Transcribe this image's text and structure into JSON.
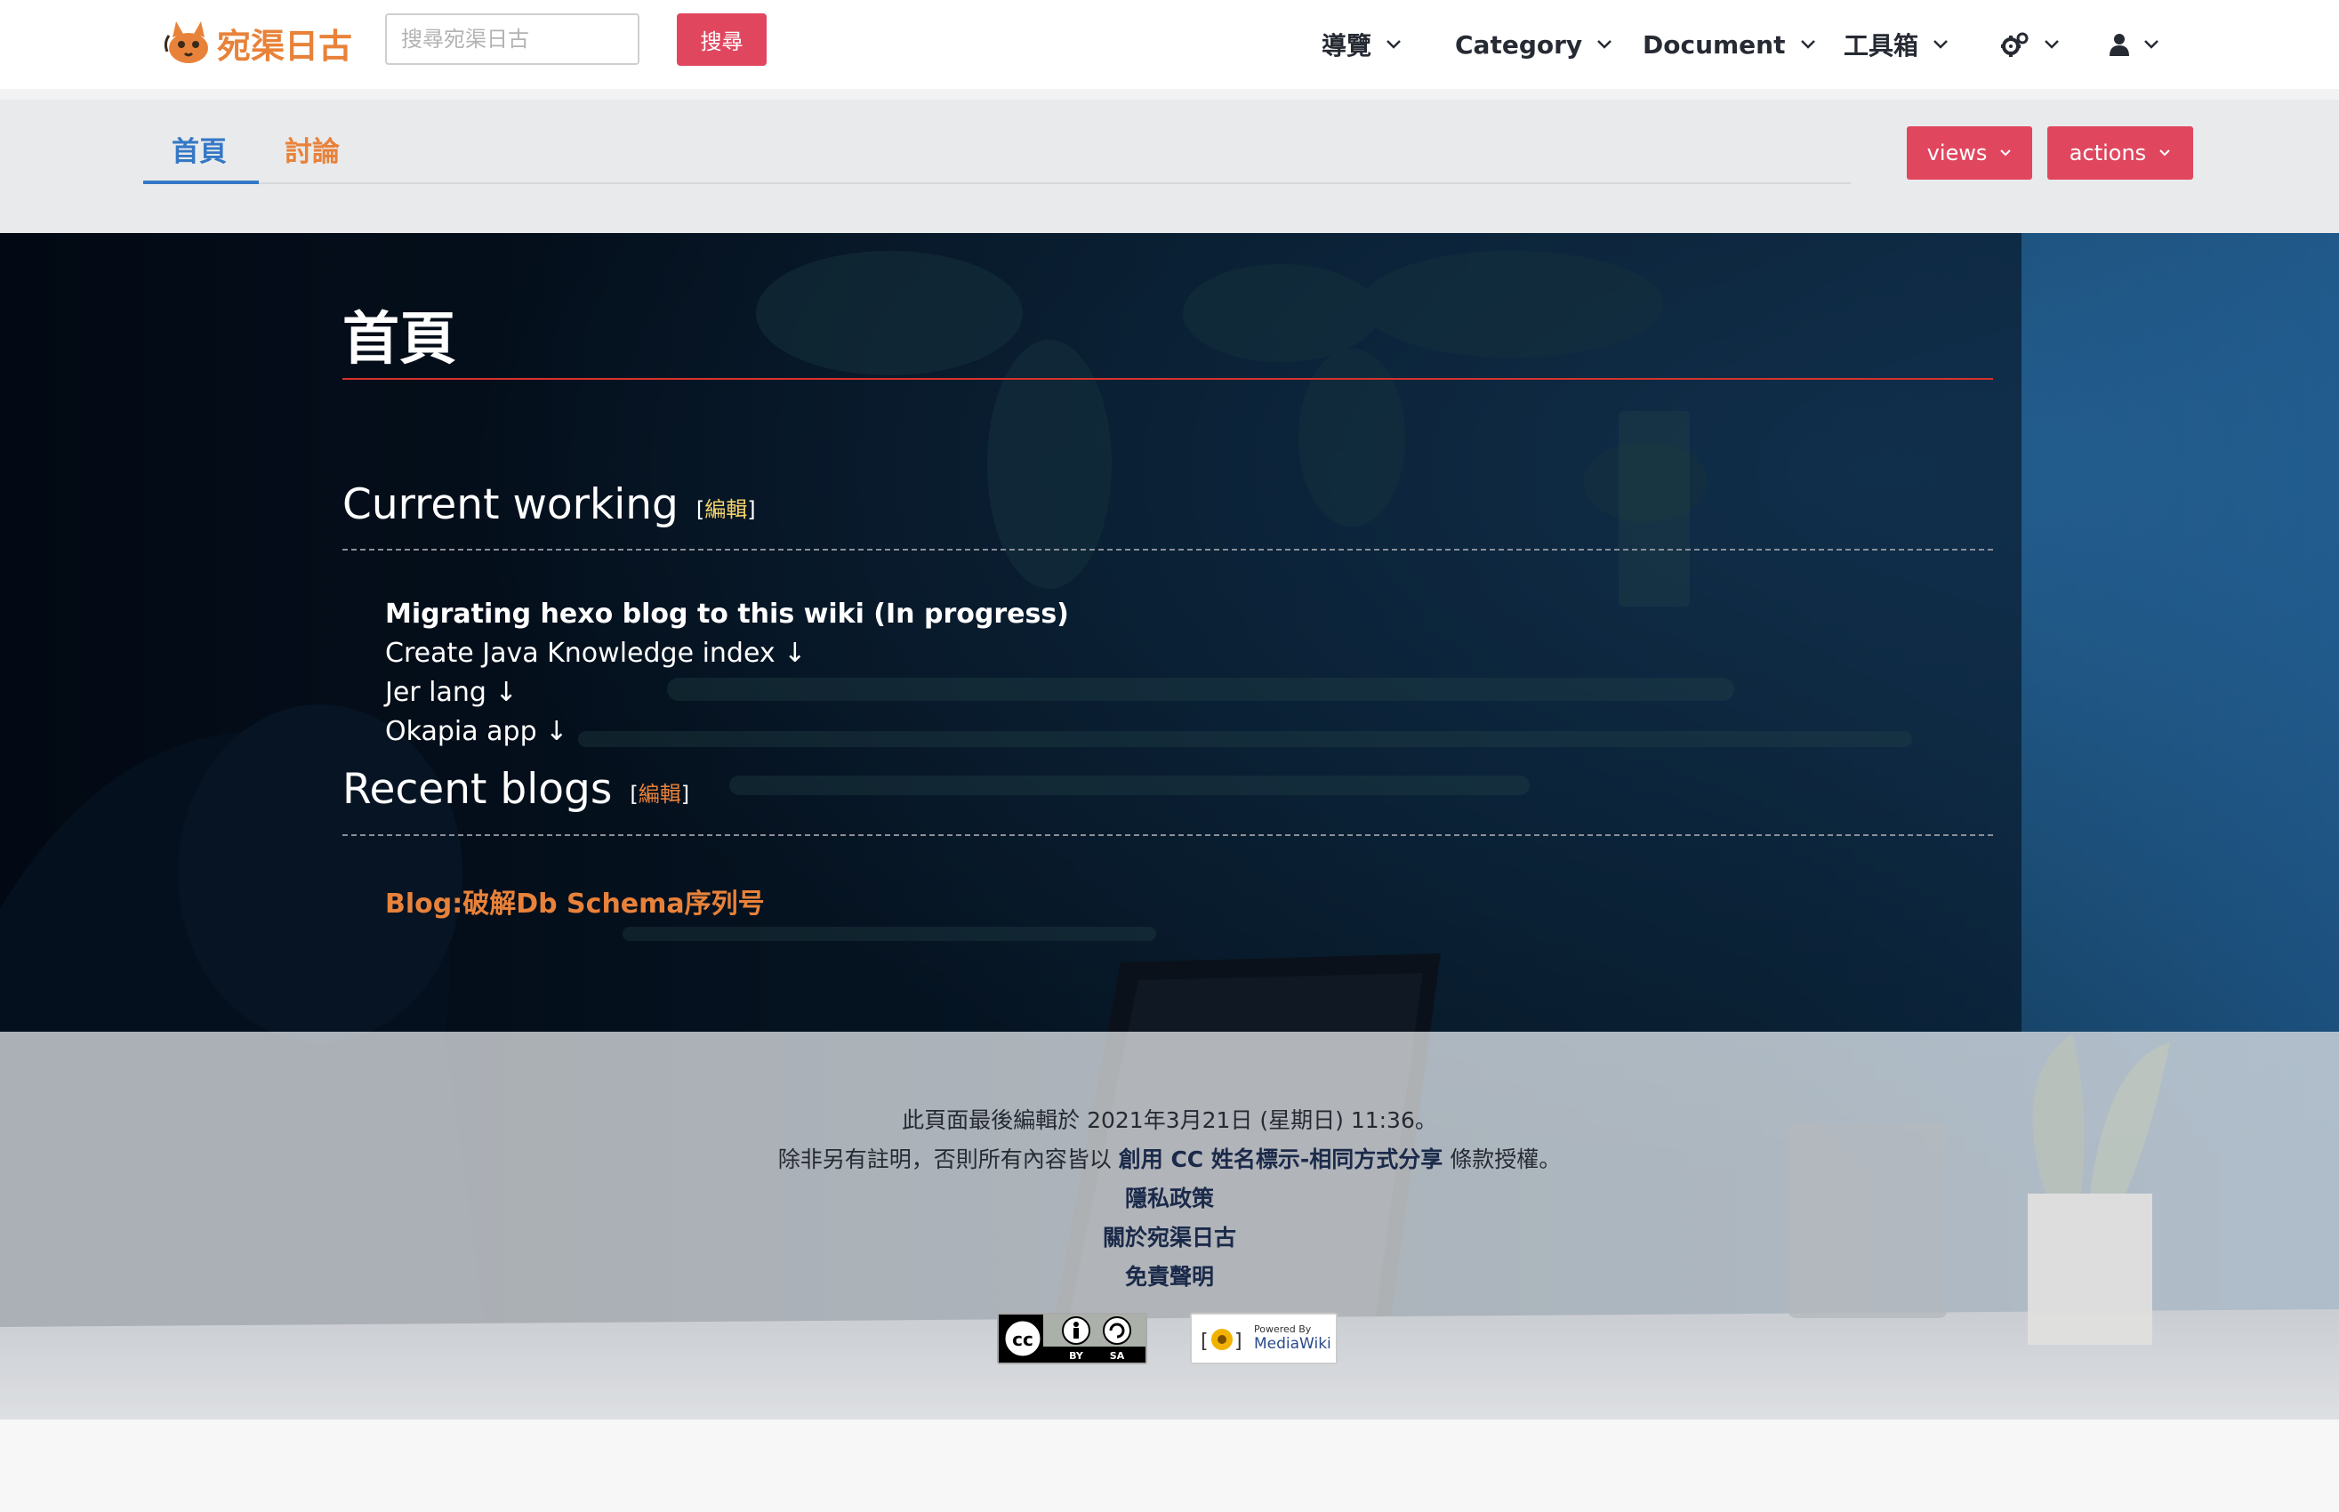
{
  "site": {
    "name": "宛渠日古",
    "logo_icon": "cat-logo-icon",
    "accent": "#e8823a",
    "brand_red": "#e0475f"
  },
  "search": {
    "placeholder": "搜尋宛渠日古",
    "button_label": "搜尋"
  },
  "nav": {
    "items": [
      {
        "label": "導覽"
      },
      {
        "label": "Category"
      },
      {
        "label": "Document"
      },
      {
        "label": "工具箱"
      }
    ],
    "settings_icon": "gears-icon",
    "user_icon": "user-icon"
  },
  "tabs": {
    "main": "首頁",
    "talk": "討論"
  },
  "menus": {
    "views": "views",
    "actions": "actions"
  },
  "page": {
    "title": "首頁",
    "edit_label": "編輯",
    "sections": [
      {
        "heading": "Current working",
        "items": [
          "Migrating hexo blog to this wiki (In progress)",
          "Create Java Knowledge index ↓",
          "Jer lang ↓",
          "Okapia app ↓"
        ]
      },
      {
        "heading": "Recent blogs",
        "items": [
          "Blog:破解Db Schema序列号"
        ]
      }
    ]
  },
  "footer": {
    "last_edited": "此頁面最後編輯於 2021年3月21日 (星期日) 11:36。",
    "license_prefix": "除非另有註明，否則所有內容皆以",
    "license_link": "創用 CC 姓名標示-相同方式分享",
    "license_suffix": "條款授權。",
    "links": [
      "隱私政策",
      "關於宛渠日古",
      "免責聲明"
    ],
    "badges": {
      "cc_icon": "cc-by-sa-badge-icon",
      "cc_by": "BY",
      "cc_sa": "SA",
      "mw_icon": "mediawiki-badge-icon",
      "mw_powered": "Powered By",
      "mw_name": "MediaWiki"
    }
  }
}
